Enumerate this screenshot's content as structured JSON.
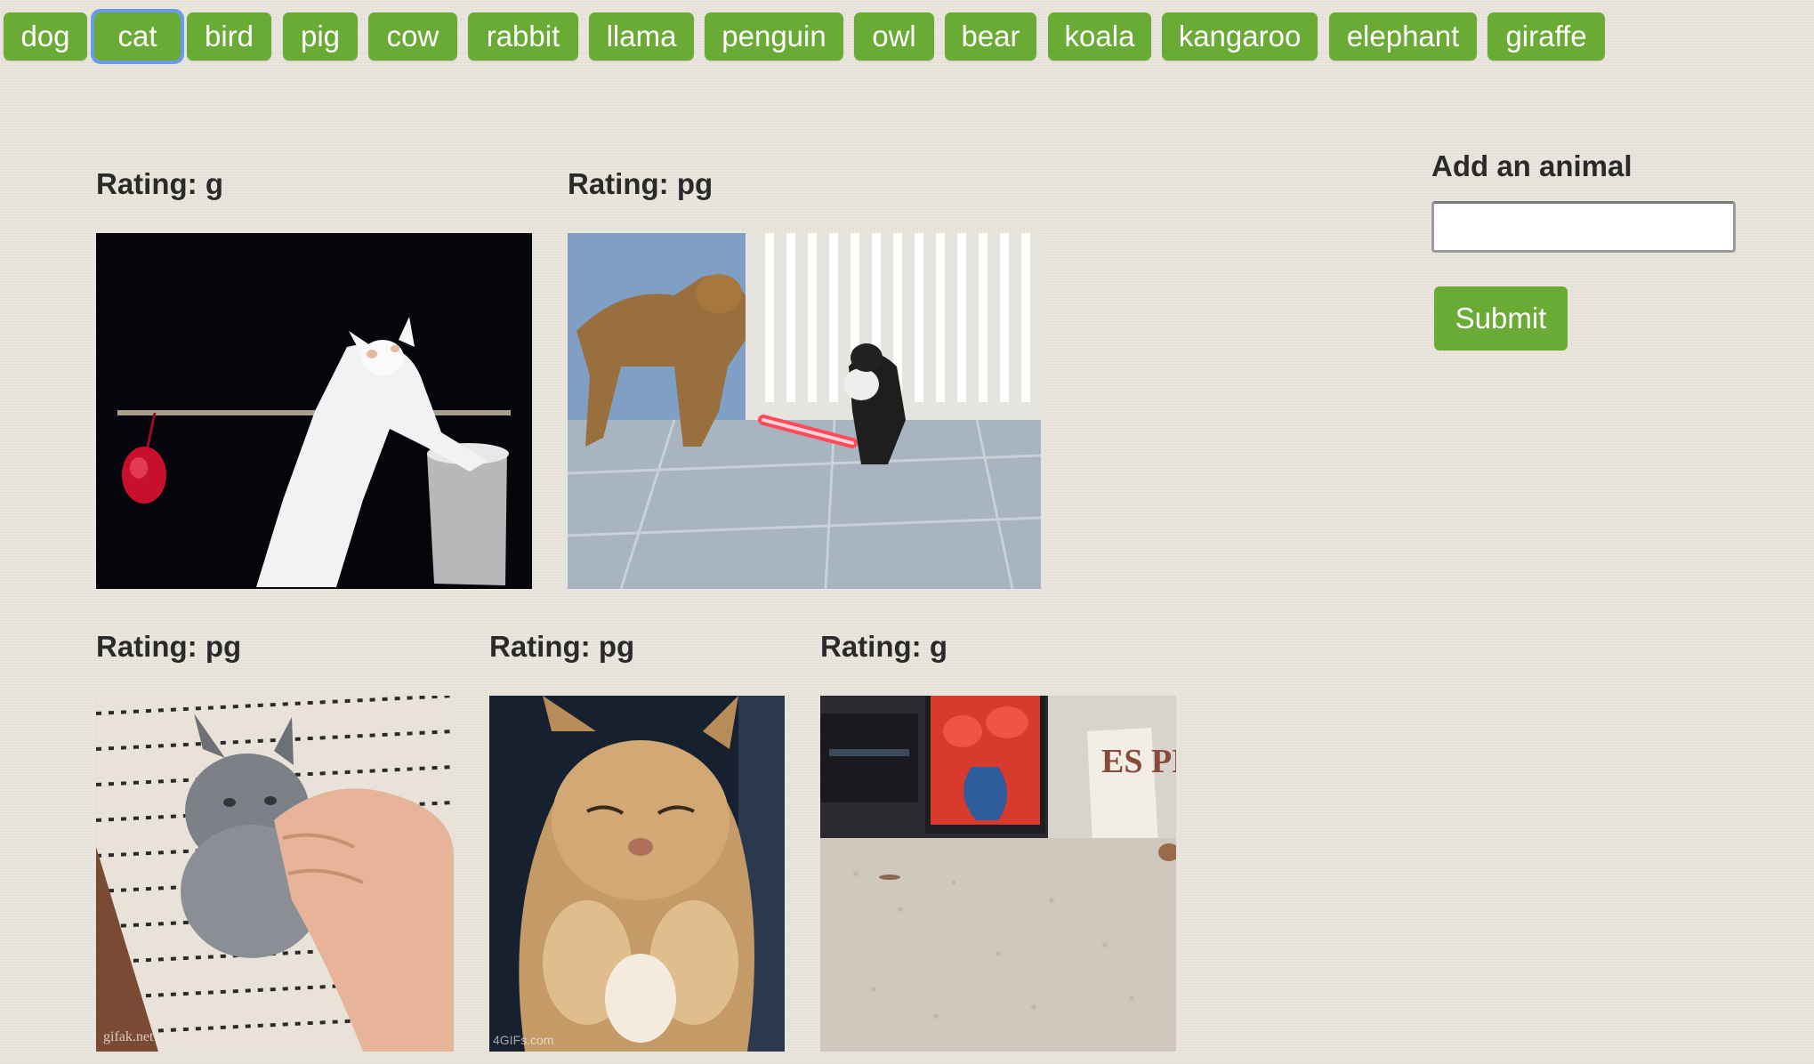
{
  "animal_buttons": [
    "dog",
    "cat",
    "bird",
    "pig",
    "cow",
    "rabbit",
    "llama",
    "penguin",
    "owl",
    "bear",
    "koala",
    "kangaroo",
    "elephant",
    "giraffe"
  ],
  "focused_button": "cat",
  "gifs": [
    {
      "rating_text": "Rating: g",
      "scene": "white-cat-playing-with-red-yarn"
    },
    {
      "rating_text": "Rating: pg",
      "scene": "dog-and-cat-with-lightsaber"
    },
    {
      "rating_text": "Rating: pg",
      "scene": "grey-kitten-with-hand"
    },
    {
      "rating_text": "Rating: pg",
      "scene": "orange-kitten-sleepy"
    },
    {
      "rating_text": "Rating: g",
      "scene": "cat-on-carpet-espn-box"
    }
  ],
  "watermarks": {
    "gif3": "gifak.net",
    "gif4": "4GIFs.com"
  },
  "espn_box_text": "ES PN",
  "form": {
    "label": "Add an animal",
    "input_value": "",
    "submit_label": "Submit"
  },
  "colors": {
    "button_green": "#6aab35",
    "focus_ring": "#6a9ae8",
    "background": "#e8e4dc"
  }
}
